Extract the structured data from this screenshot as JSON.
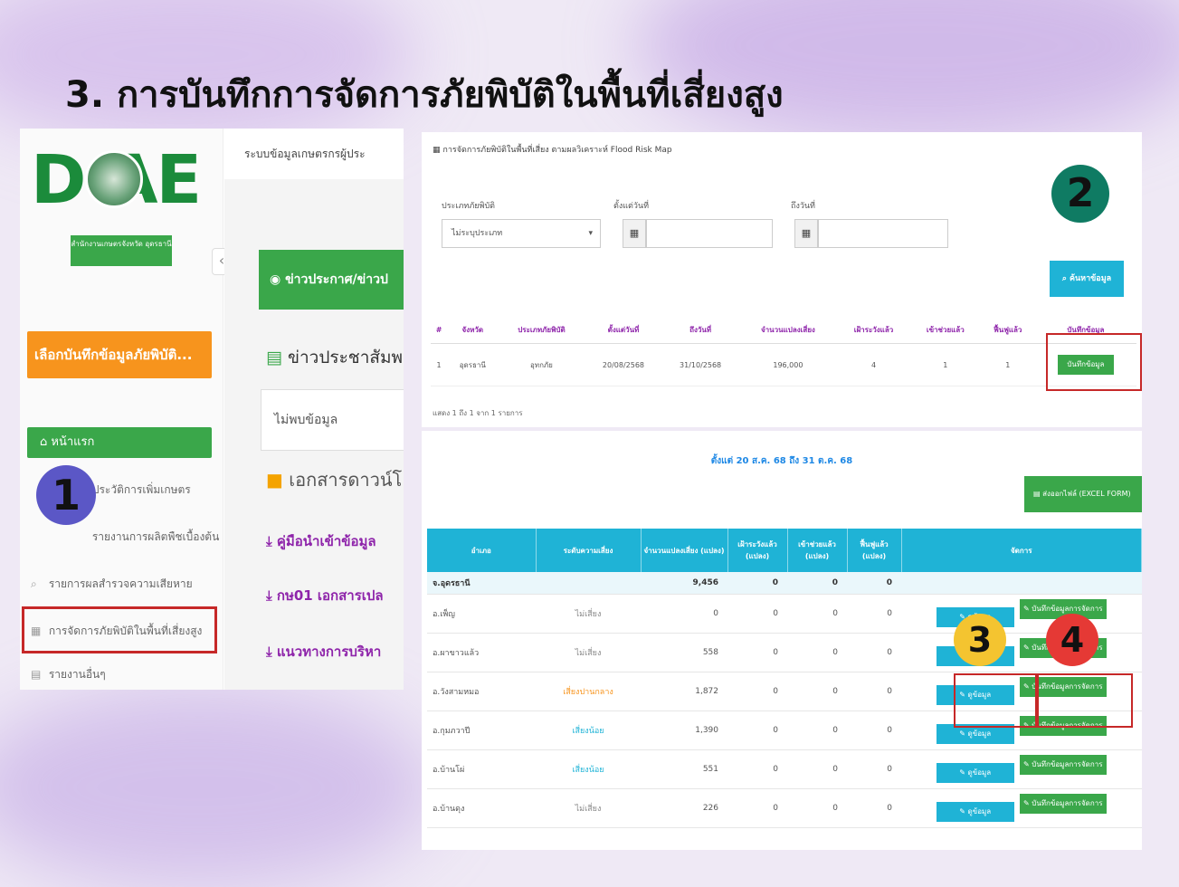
{
  "slide": {
    "title": "3. การบันทึกการจัดการภัยพิบัติในพื้นที่เสี่ยงสูง"
  },
  "panel1": {
    "logo_text": "D AE",
    "logo_sub": "สำนักงานเกษตรจังหวัด อุดรธานี",
    "topbar_text": "ระบบข้อมูลเกษตรกรผู้ประ",
    "orange_button": "เลือกบันทึกข้อมูลภัยพิบัติ...",
    "nav": {
      "home": "หน้าแรก",
      "items": [
        "ประวัติการเพิ่มเกษตร",
        "รายงานการผลิตพืชเบื้องต้น",
        "รายการผลสำรวจความเสียหาย",
        "การจัดการภัยพิบัติในพื้นที่เสี่ยงสูง",
        "รายงานอื่นๆ"
      ]
    },
    "main": {
      "green_header": "ข่าวประกาศ/ข่าวป",
      "news_title": "ข่าวประชาสัมพ",
      "no_data": "ไม่พบข้อมูล",
      "docs_title": "เอกสารดาวน์โ",
      "links": [
        "คู่มือนำเข้าข้อมูล",
        "กษ01 เอกสารเปล",
        "แนวทางการบริหา"
      ]
    },
    "marker": "1"
  },
  "panel2": {
    "title": "การจัดการภัยพิบัติในพื้นที่เสี่ยง ตามผลวิเคราะห์ Flood Risk Map",
    "filters": {
      "type_label": "ประเภทภัยพิบัติ",
      "type_value": "ไม่ระบุประเภท",
      "start_label": "ตั้งแต่วันที่",
      "end_label": "ถึงวันที่"
    },
    "search_button": "ค้นหาข้อมูล",
    "marker": "2",
    "columns": [
      "#",
      "จังหวัด",
      "ประเภทภัยพิบัติ",
      "ตั้งแต่วันที่",
      "ถึงวันที่",
      "จำนวนแปลงเสี่ยง",
      "เฝ้าระวังแล้ว",
      "เข้าช่วยแล้ว",
      "ฟื้นฟูแล้ว",
      "บันทึกข้อมูล"
    ],
    "rows": [
      [
        "1",
        "อุดรธานี",
        "อุทกภัย",
        "20/08/2568",
        "31/10/2568",
        "196,000",
        "4",
        "1",
        "1",
        "บันทึกข้อมูล"
      ]
    ],
    "footer": "แสดง 1 ถึง 1 จาก 1 รายการ"
  },
  "panel3": {
    "title": "ตั้งแต่ 20 ส.ค. 68 ถึง 31 ต.ค. 68",
    "export_button": "ส่งออกไฟล์ (EXCEL FORM)",
    "columns": [
      "อำเภอ",
      "ระดับความเสี่ยง",
      "จำนวนแปลงเสี่ยง (แปลง)",
      "เฝ้าระวังแล้ว (แปลง)",
      "เข้าช่วยแล้ว (แปลง)",
      "ฟื้นฟูแล้ว (แปลง)",
      "จัดการ"
    ],
    "group": {
      "name": "จ.อุดรธานี",
      "value": "9,456",
      "c1": "0",
      "c2": "0",
      "c3": "0"
    },
    "rows": [
      {
        "name": "อ.เพ็ญ",
        "risk": "ไม่เสี่ยง",
        "risk_class": "risk-none",
        "v": "0",
        "a": "0",
        "b": "0",
        "c": "0"
      },
      {
        "name": "อ.ผาขาวแล้ว",
        "risk": "ไม่เสี่ยง",
        "risk_class": "risk-none",
        "v": "558",
        "a": "0",
        "b": "0",
        "c": "0"
      },
      {
        "name": "อ.วังสามหมอ",
        "risk": "เสี่ยงปานกลาง",
        "risk_class": "risk-high",
        "v": "1,872",
        "a": "0",
        "b": "0",
        "c": "0"
      },
      {
        "name": "อ.กุมภวาปี",
        "risk": "เสี่ยงน้อย",
        "risk_class": "risk-low",
        "v": "1,390",
        "a": "0",
        "b": "0",
        "c": "0"
      },
      {
        "name": "อ.บ้านโผ่",
        "risk": "เสี่ยงน้อย",
        "risk_class": "risk-low",
        "v": "551",
        "a": "0",
        "b": "0",
        "c": "0"
      },
      {
        "name": "อ.บ้านดุง",
        "risk": "ไม่เสี่ยง",
        "risk_class": "risk-none",
        "v": "226",
        "a": "0",
        "b": "0",
        "c": "0"
      }
    ],
    "view_label": "ดูข้อมูล",
    "record_label": "บันทึกข้อมูลการจัดการ",
    "marker3": "3",
    "marker4": "4"
  },
  "colors": {
    "green": "#3aa74a",
    "cyan": "#1fb3d6",
    "orange": "#f7941d",
    "purple_marker": "#5b57c6",
    "teal_marker": "#0f7b63",
    "yellow_marker": "#f4c430",
    "red_marker": "#e53935",
    "highlight": "#c62828"
  }
}
